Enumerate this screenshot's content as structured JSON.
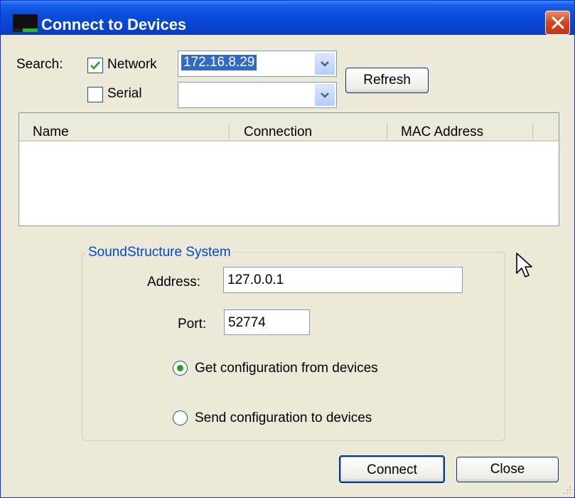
{
  "window": {
    "title": "Connect to Devices"
  },
  "search": {
    "label": "Search:",
    "network": {
      "label": "Network",
      "checked": true,
      "value": "172.16.8.29"
    },
    "serial": {
      "label": "Serial",
      "checked": false,
      "value": ""
    },
    "refresh_label": "Refresh"
  },
  "devices_list": {
    "columns": [
      "Name",
      "Connection",
      "MAC Address"
    ],
    "rows": []
  },
  "soundstructure": {
    "legend": "SoundStructure System",
    "address_label": "Address:",
    "address_value": "127.0.0.1",
    "port_label": "Port:",
    "port_value": "52774",
    "options": [
      {
        "label": "Get configuration from devices",
        "selected": true
      },
      {
        "label": "Send configuration to devices",
        "selected": false
      }
    ]
  },
  "buttons": {
    "connect": "Connect",
    "close": "Close"
  },
  "icons": [
    "app-icon",
    "close-icon",
    "checkmark-icon",
    "dropdown-arrow-icon",
    "mouse-cursor-icon",
    "resize-grip-icon"
  ]
}
